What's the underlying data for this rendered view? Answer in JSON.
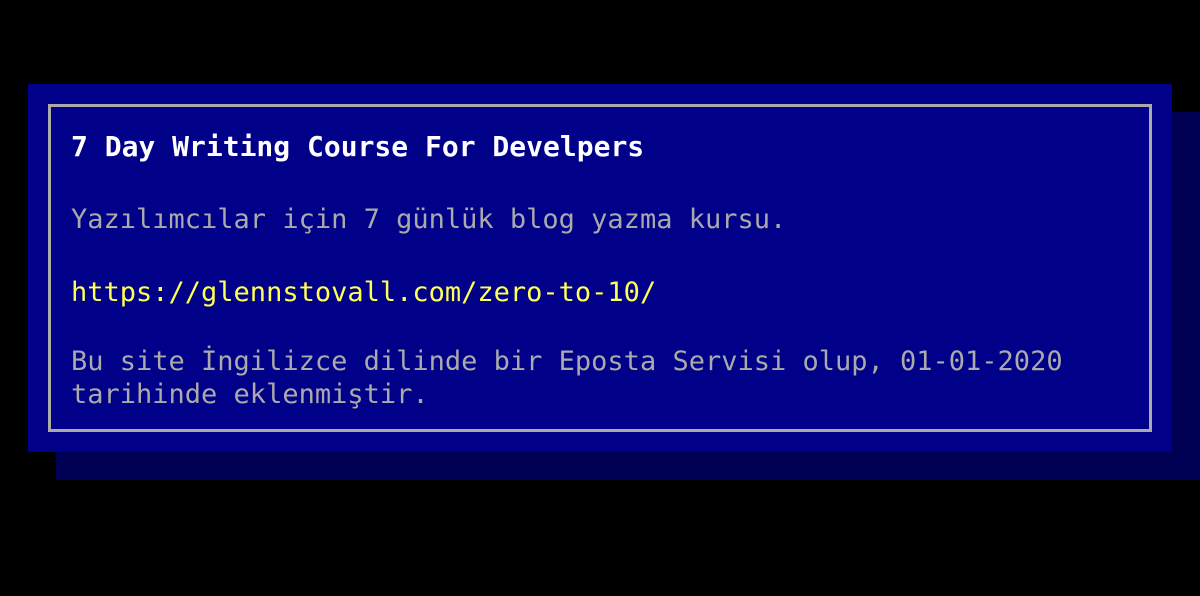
{
  "card": {
    "title": "7 Day Writing Course For Develpers",
    "description": "Yazılımcılar için 7 günlük blog yazma kursu.",
    "url": "https://glennstovall.com/zero-to-10/",
    "info_line1": "Bu site İngilizce dilinde bir Eposta Servisi olup, 01-01-2020",
    "info_line2": "tarihinde eklenmiştir."
  },
  "colors": {
    "background": "#000000",
    "panel": "#000088",
    "shadow": "#000055",
    "border": "#aaaaaa",
    "title": "#ffffff",
    "text": "#aaaaaa",
    "link": "#ffff55"
  }
}
